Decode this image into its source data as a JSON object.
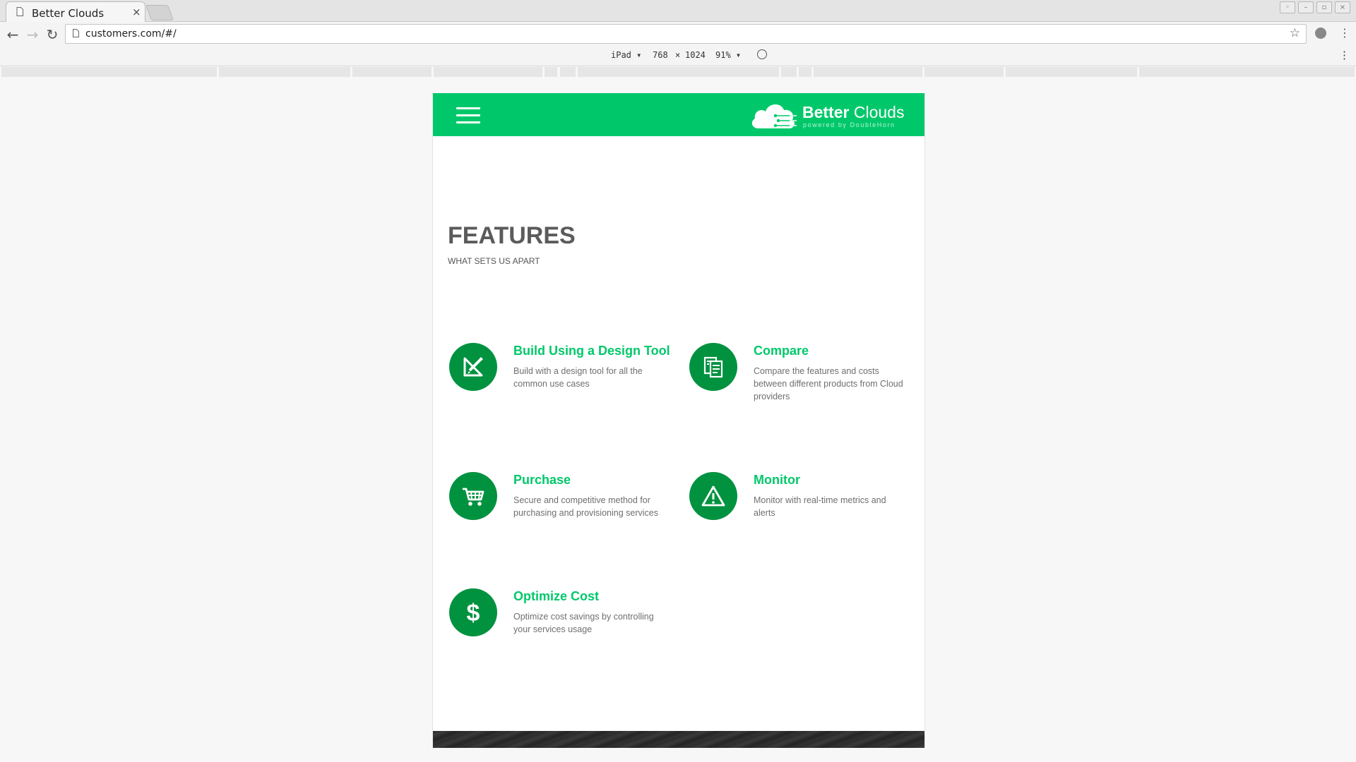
{
  "browser": {
    "tab_title": "Better Clouds",
    "tab_close": "×",
    "url": "customers.com/#/",
    "star": "☆",
    "menu": "⋮"
  },
  "devtools": {
    "device": "iPad ▾",
    "width": "768",
    "times": "×",
    "height": "1024",
    "zoom": "91% ▾",
    "menu": "⋮"
  },
  "header": {
    "logo_bold": "Better",
    "logo_light": " Clouds",
    "logo_tagline": "powered by DoubleHorn"
  },
  "features": {
    "title": "FEATURES",
    "subtitle": "WHAT SETS US APART",
    "items": [
      {
        "title": "Build Using a Design Tool",
        "desc": "Build with a design tool for all the common use cases",
        "icon": "design-tool-icon"
      },
      {
        "title": "Compare",
        "desc": "Compare the features and costs between different products from Cloud providers",
        "icon": "compare-icon"
      },
      {
        "title": "Purchase",
        "desc": "Secure and competitive method for purchasing and provisioning services",
        "icon": "cart-icon"
      },
      {
        "title": "Monitor",
        "desc": "Monitor with real-time metrics and alerts",
        "icon": "warning-icon"
      },
      {
        "title": "Optimize Cost",
        "desc": "Optimize cost savings by controlling your services usage",
        "icon": "dollar-icon"
      }
    ]
  },
  "colors": {
    "brand_green": "#00c86a",
    "icon_green": "#00923f",
    "heading_gray": "#5b5b5b"
  }
}
